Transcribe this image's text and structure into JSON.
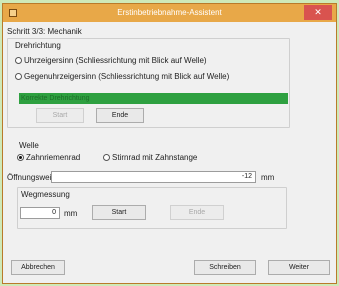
{
  "window": {
    "title": "Erstinbetriebnahme-Assistent",
    "close": "✕"
  },
  "step_label": "Schritt 3/3: Mechanik",
  "direction": {
    "group_label": "Drehrichtung",
    "option_cw": "Uhrzeigersinn (Schliessrichtung mit Blick auf Welle)",
    "option_ccw": "Gegenuhrzeigersinn (Schliessrichtung mit Blick auf Welle)",
    "selected": "none",
    "status_text": "Korrekte Drehrichtung",
    "start_label": "Start",
    "end_label": "Ende"
  },
  "shaft": {
    "group_label": "Welle",
    "option_gear": "Zahnriemenrad",
    "option_rack": "Stirnrad mit Zahnstange",
    "selected": "gear"
  },
  "opening": {
    "label": "Öffnungsweite",
    "value": "-12",
    "unit": "mm"
  },
  "travel": {
    "group_label": "Wegmessung",
    "value": "0",
    "unit": "mm",
    "start_label": "Start",
    "end_label": "Ende"
  },
  "footer": {
    "cancel_label": "Abbrechen",
    "write_label": "Schreiben",
    "next_label": "Weiter"
  },
  "colors": {
    "titlebar": "#e8a848",
    "status_green": "#2ea040",
    "desktop": "#cfe9b8"
  }
}
